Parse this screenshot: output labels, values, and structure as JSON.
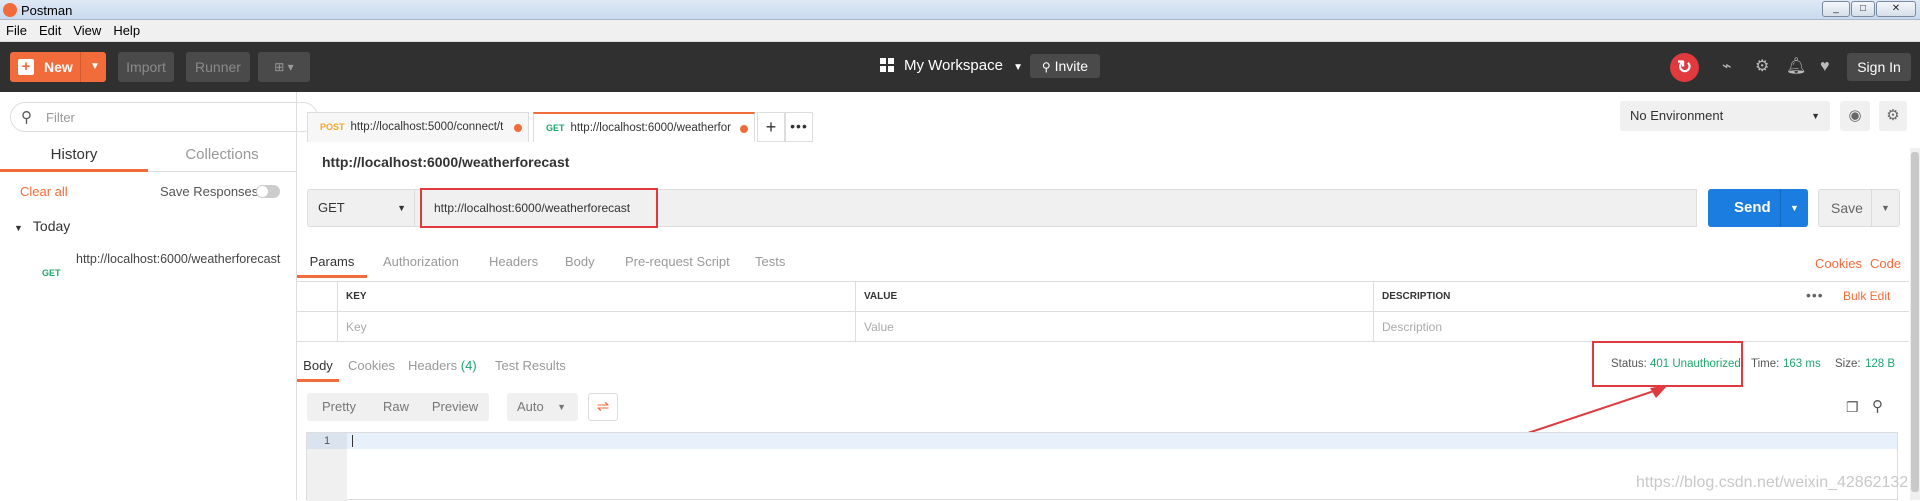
{
  "window": {
    "title": "Postman",
    "controls": [
      "_",
      "□",
      "✕"
    ]
  },
  "menu": [
    "File",
    "Edit",
    "View",
    "Help"
  ],
  "header": {
    "new_label": "New",
    "import_label": "Import",
    "runner_label": "Runner",
    "workspace_label": "My Workspace",
    "invite_label": "Invite",
    "signin_label": "Sign In"
  },
  "sidebar": {
    "filter_placeholder": "Filter",
    "tabs": [
      "History",
      "Collections"
    ],
    "clear_all": "Clear all",
    "save_responses": "Save Responses",
    "group": "Today",
    "items": [
      {
        "method": "GET",
        "url": "http://localhost:6000/weatherforecast"
      }
    ]
  },
  "tabs": [
    {
      "method": "POST",
      "method_color": "#f5a623",
      "url": "http://localhost:5000/connect/t"
    },
    {
      "method": "GET",
      "method_color": "#1fa56e",
      "url": "http://localhost:6000/weatherfor"
    }
  ],
  "tab_more": "•••",
  "environment": {
    "label": "No Environment"
  },
  "request": {
    "title": "http://localhost:6000/weatherforecast",
    "method": "GET",
    "url": "http://localhost:6000/weatherforecast",
    "send_label": "Send",
    "save_label": "Save"
  },
  "subtabs": [
    "Params",
    "Authorization",
    "Headers",
    "Body",
    "Pre-request Script",
    "Tests"
  ],
  "links": {
    "cookies": "Cookies",
    "code": "Code"
  },
  "params": {
    "headers": [
      "KEY",
      "VALUE",
      "DESCRIPTION"
    ],
    "placeholders": [
      "Key",
      "Value",
      "Description"
    ],
    "bulk_edit": "Bulk Edit",
    "more": "•••"
  },
  "response": {
    "tabs": {
      "body": "Body",
      "cookies": "Cookies",
      "headers": "Headers",
      "headers_count": "(4)",
      "tests": "Test Results"
    },
    "status_label": "Status:",
    "status_value": "401 Unauthorized",
    "time_label": "Time:",
    "time_value": "163 ms",
    "size_label": "Size:",
    "size_value": "128 B",
    "views": [
      "Pretty",
      "Raw",
      "Preview"
    ],
    "format": "Auto",
    "line_number": "1"
  },
  "watermark": "https://blog.csdn.net/weixin_42862132",
  "colors": {
    "accent": "#f26b3a",
    "send": "#1b7ddf",
    "success": "#1fa56e",
    "highlight": "#e0393e"
  }
}
